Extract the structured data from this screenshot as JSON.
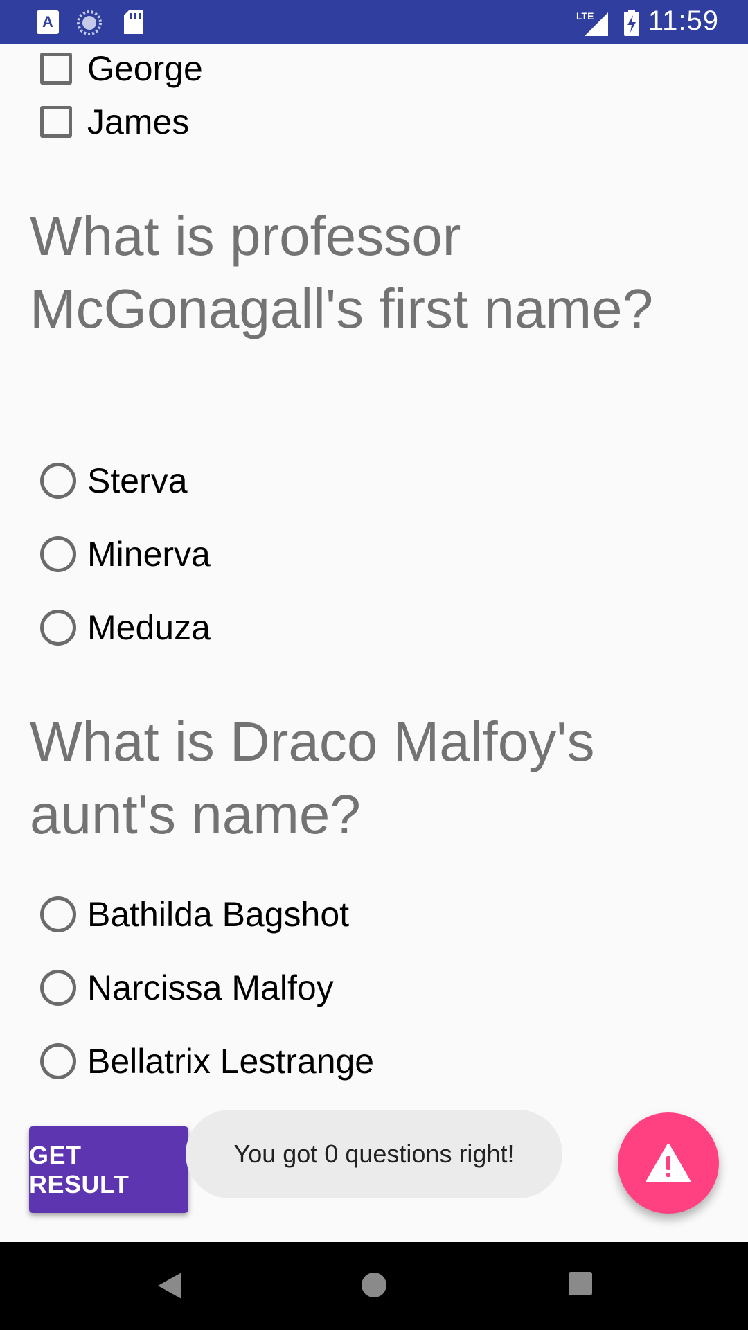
{
  "status_bar": {
    "time": "11:59",
    "left_icons": [
      "a-notification-icon",
      "sync-icon",
      "sd-card-icon"
    ],
    "right_icons": [
      "lte-signal-icon",
      "battery-charging-icon"
    ]
  },
  "quiz": {
    "previous_options": [
      {
        "label": "George",
        "type": "checkbox",
        "checked": false
      },
      {
        "label": "James",
        "type": "checkbox",
        "checked": false
      }
    ],
    "questions": [
      {
        "text": "What is professor McGonagall's first name?",
        "options": [
          {
            "label": "Sterva",
            "selected": false
          },
          {
            "label": "Minerva",
            "selected": false
          },
          {
            "label": "Meduza",
            "selected": false
          }
        ]
      },
      {
        "text": "What is Draco Malfoy's aunt's name?",
        "options": [
          {
            "label": "Bathilda Bagshot",
            "selected": false
          },
          {
            "label": "Narcissa Malfoy",
            "selected": false
          },
          {
            "label": "Bellatrix Lestrange",
            "selected": false
          }
        ]
      }
    ]
  },
  "actions": {
    "get_result_label": "GET RESULT",
    "toast_message": "You got 0 questions right!",
    "fab_icon": "warning-icon"
  },
  "colors": {
    "status_bar": "#303f9f",
    "button": "#5e35b1",
    "fab": "#ff4081",
    "question_text": "#737373"
  },
  "nav_bar": {
    "icons": [
      "back-icon",
      "home-icon",
      "recents-icon"
    ]
  }
}
